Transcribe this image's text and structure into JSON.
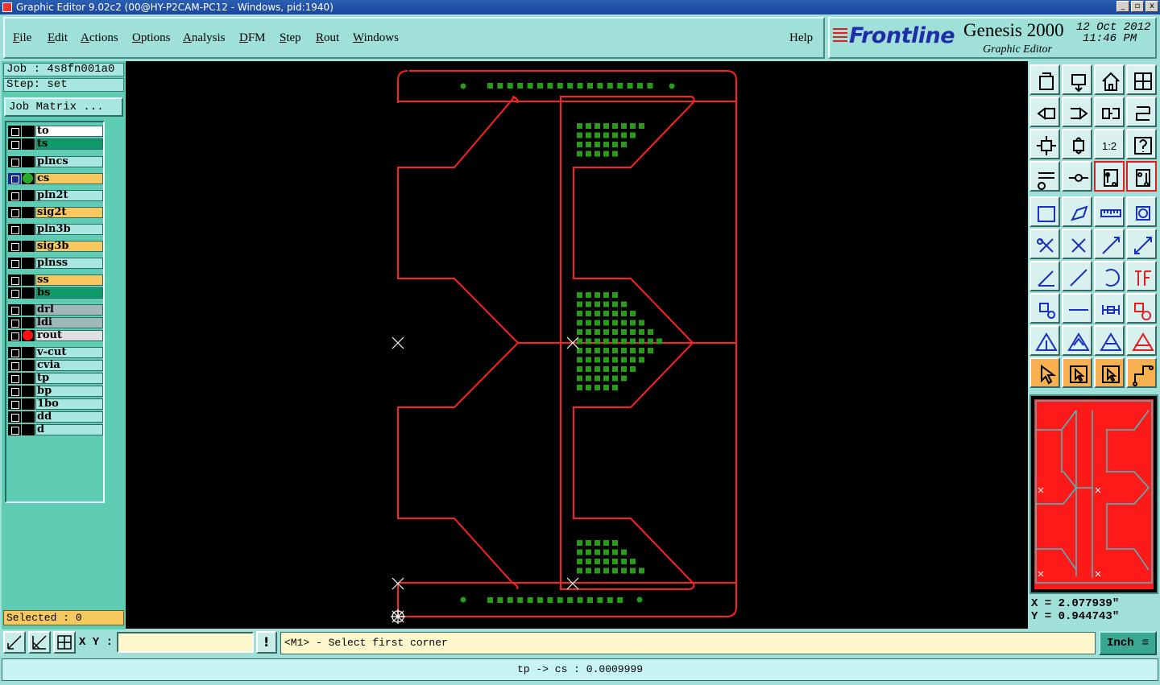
{
  "window": {
    "title": "Graphic Editor 9.02c2 (00@HY-P2CAM-PC12 - Windows, pid:1940)",
    "buttons": [
      "_",
      "▫",
      "x"
    ]
  },
  "menu": {
    "items": [
      {
        "first": "F",
        "rest": "ile"
      },
      {
        "first": "E",
        "rest": "dit"
      },
      {
        "first": "A",
        "rest": "ctions"
      },
      {
        "first": "O",
        "rest": "ptions"
      },
      {
        "first": "A",
        "rest": "nalysis"
      },
      {
        "first": "D",
        "rest": "FM"
      },
      {
        "first": "S",
        "rest": "tep"
      },
      {
        "first": "R",
        "rest": "out"
      },
      {
        "first": "W",
        "rest": "indows"
      }
    ],
    "help": "Help"
  },
  "brand": {
    "logo": "Frontline",
    "product": "Genesis 2000",
    "subtitle": "Graphic Editor",
    "date": "12 Oct 2012",
    "time": "11:46 PM"
  },
  "job": {
    "job_label": "Job : 4s8fn001a0",
    "step_label": "Step: set",
    "matrix_button": "Job Matrix ..."
  },
  "layers": [
    {
      "name": "to",
      "color": "#ffffff",
      "dot": ""
    },
    {
      "name": "ts",
      "color": "#0f9a6a",
      "dot": ""
    },
    {
      "name": "plncs",
      "color": "#a8e6e0",
      "dot": ""
    },
    {
      "name": "cs",
      "color": "#f8c860",
      "dot": "#2aa82a",
      "active": true
    },
    {
      "name": "pln2t",
      "color": "#a8e6e0",
      "dot": ""
    },
    {
      "name": "sig2t",
      "color": "#f8c860",
      "dot": ""
    },
    {
      "name": "pln3b",
      "color": "#a8e6e0",
      "dot": ""
    },
    {
      "name": "sig3b",
      "color": "#f8c860",
      "dot": ""
    },
    {
      "name": "plnss",
      "color": "#a8e6e0",
      "dot": ""
    },
    {
      "name": "ss",
      "color": "#f8c860",
      "dot": ""
    },
    {
      "name": "bs",
      "color": "#0f9a6a",
      "dot": ""
    },
    {
      "name": "drl",
      "color": "#a0b8b8",
      "dot": ""
    },
    {
      "name": "ldi",
      "color": "#a0b8b8",
      "dot": ""
    },
    {
      "name": "rout",
      "color": "#e0e0e0",
      "dot": "#ff1010"
    },
    {
      "name": "v-cut",
      "color": "#a8e6e0",
      "dot": ""
    },
    {
      "name": "cvia",
      "color": "#a8e6e0",
      "dot": ""
    },
    {
      "name": "tp",
      "color": "#a8e6e0",
      "dot": ""
    },
    {
      "name": "bp",
      "color": "#a8e6e0",
      "dot": ""
    },
    {
      "name": "1bo",
      "color": "#a8e6e0",
      "dot": ""
    },
    {
      "name": "dd",
      "color": "#a8e6e0",
      "dot": ""
    },
    {
      "name": "d",
      "color": "#a8e6e0",
      "dot": ""
    }
  ],
  "selected": "Selected : 0",
  "coords": {
    "x": "X = 2.077939\"",
    "y": "Y = 0.944743\""
  },
  "bottom": {
    "xy_label": "X Y :",
    "xy_value": "",
    "prompt": "<M1> - Select first corner",
    "unit": "Inch",
    "status": "tp -> cs : 0.0009999"
  },
  "colors": {
    "route": "#ff2020",
    "pad": "#2a9a1a",
    "canvas": "#000000",
    "panel": "#9fe0d8"
  }
}
